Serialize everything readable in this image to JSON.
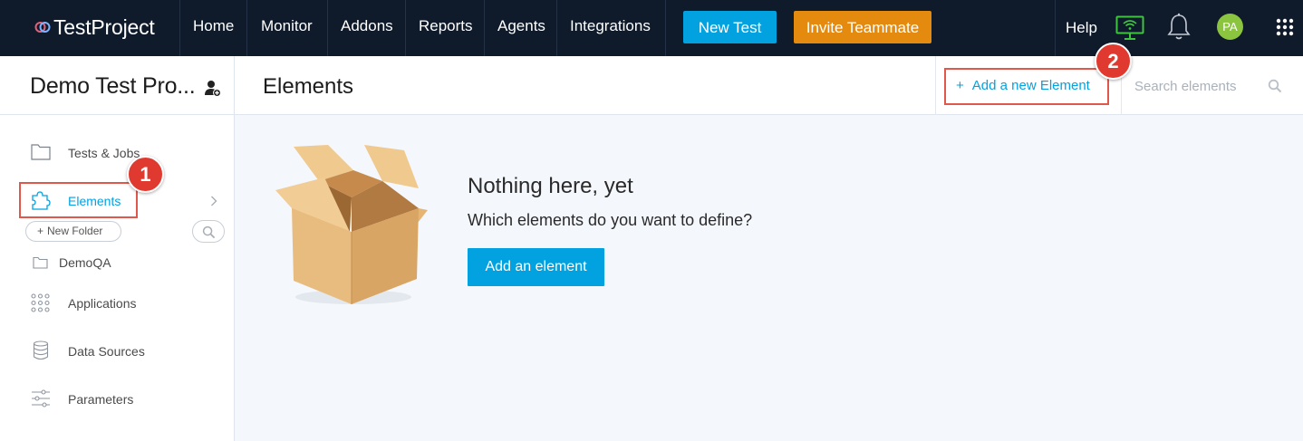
{
  "topbar": {
    "logo_text": "TestProject",
    "nav": [
      "Home",
      "Monitor",
      "Addons",
      "Reports",
      "Agents",
      "Integrations"
    ],
    "new_test": "New Test",
    "invite": "Invite Teammate",
    "help": "Help",
    "avatar_initials": "PA",
    "icons": [
      "monitor-wifi-icon",
      "bell-icon",
      "apps-grid-icon"
    ],
    "colors": {
      "bar": "#0f1a2b",
      "new_test": "#02a2e0",
      "invite": "#e48b0f",
      "agent_status": "#3ec43e",
      "avatar": "#8bc53f"
    }
  },
  "header": {
    "project_title": "Demo Test Pro...",
    "page_title": "Elements",
    "add_link_icon": "+",
    "add_link": "Add a new Element",
    "search_placeholder": "Search elements"
  },
  "sidebar": {
    "items": [
      {
        "label": "Tests & Jobs",
        "icon": "folder-icon"
      },
      {
        "label": "Elements",
        "icon": "puzzle-icon",
        "active": true
      },
      {
        "label": "Applications",
        "icon": "grid-dots-icon"
      },
      {
        "label": "Data Sources",
        "icon": "database-icon"
      },
      {
        "label": "Parameters",
        "icon": "sliders-icon"
      }
    ],
    "new_folder_icon": "+",
    "new_folder": "New Folder",
    "folder": "DemoQA"
  },
  "main": {
    "empty_title": "Nothing here, yet",
    "empty_subtitle": "Which elements do you want to define?",
    "button": "Add an element"
  },
  "annotations": {
    "badge1": "1",
    "badge2": "2",
    "color": "#e03a30"
  }
}
